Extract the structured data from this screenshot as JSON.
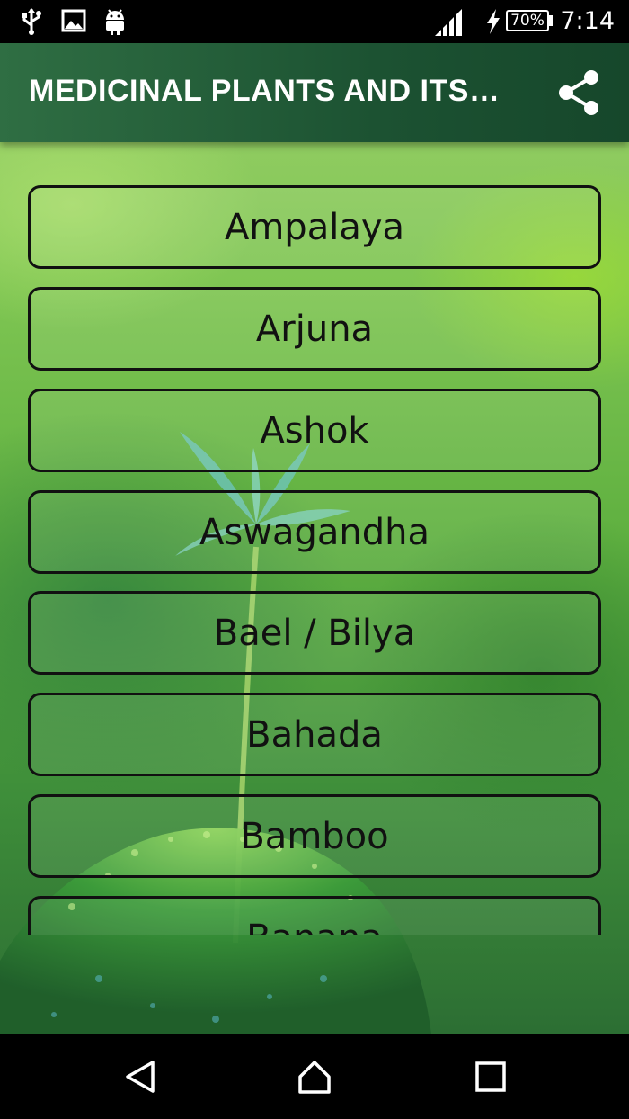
{
  "status_bar": {
    "time": "7:14",
    "battery_text": "70%",
    "battery_level": 0.7,
    "icons": [
      "usb-icon",
      "image-icon",
      "android-icon",
      "signal-icon",
      "charging-icon"
    ]
  },
  "app_bar": {
    "title": "MEDICINAL PLANTS AND ITS…",
    "share_icon": "share-icon"
  },
  "plants": [
    {
      "label": "Ampalaya"
    },
    {
      "label": "Arjuna"
    },
    {
      "label": "Ashok"
    },
    {
      "label": "Aswagandha"
    },
    {
      "label": "Bael / Bilya"
    },
    {
      "label": "Bahada"
    },
    {
      "label": "Bamboo"
    },
    {
      "label": "Banana"
    }
  ],
  "nav_bar": {
    "icons": [
      "back-icon",
      "home-icon",
      "recents-icon"
    ]
  },
  "colors": {
    "app_bar": "#1c5232",
    "button_border": "#111111",
    "status_bar": "#000000"
  }
}
